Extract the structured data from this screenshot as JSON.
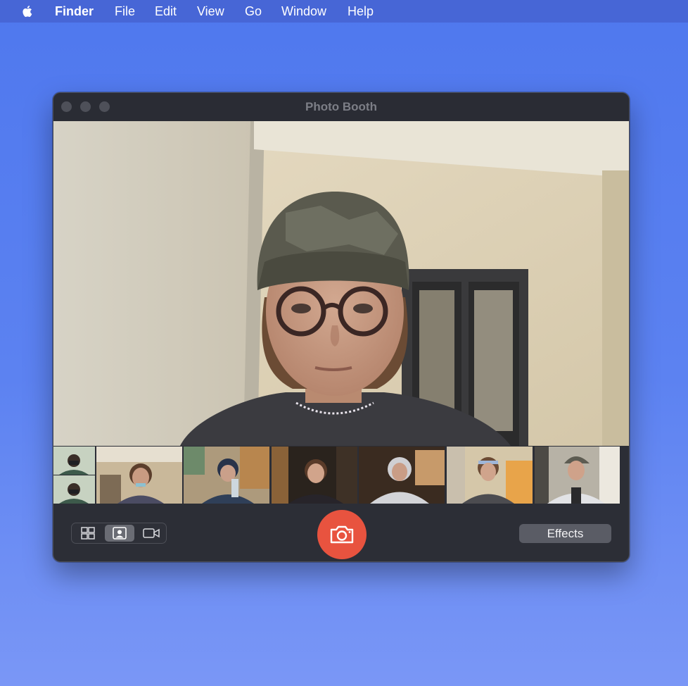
{
  "menubar": {
    "apple_icon": "apple-logo-icon",
    "items": [
      "Finder",
      "File",
      "Edit",
      "View",
      "Go",
      "Window",
      "Help"
    ]
  },
  "window": {
    "title": "Photo Booth",
    "traffic_lights": [
      "close",
      "minimize",
      "zoom"
    ]
  },
  "toolbar": {
    "modes": [
      {
        "name": "grid-view",
        "icon": "grid-icon",
        "selected": false
      },
      {
        "name": "single-photo",
        "icon": "portrait-photo-icon",
        "selected": true
      },
      {
        "name": "video",
        "icon": "video-camera-icon",
        "selected": false
      }
    ],
    "shutter_icon": "camera-icon",
    "effects_label": "Effects"
  },
  "thumbnails": [
    {
      "kind": "four-up"
    },
    {
      "kind": "photo"
    },
    {
      "kind": "photo"
    },
    {
      "kind": "photo"
    },
    {
      "kind": "photo"
    },
    {
      "kind": "photo"
    },
    {
      "kind": "photo"
    }
  ],
  "colors": {
    "desktop": "#5c82f1",
    "menubar": "#4766d6",
    "window": "#2c2e36",
    "shutter": "#e8533f",
    "effects_button": "#5a5c65"
  }
}
